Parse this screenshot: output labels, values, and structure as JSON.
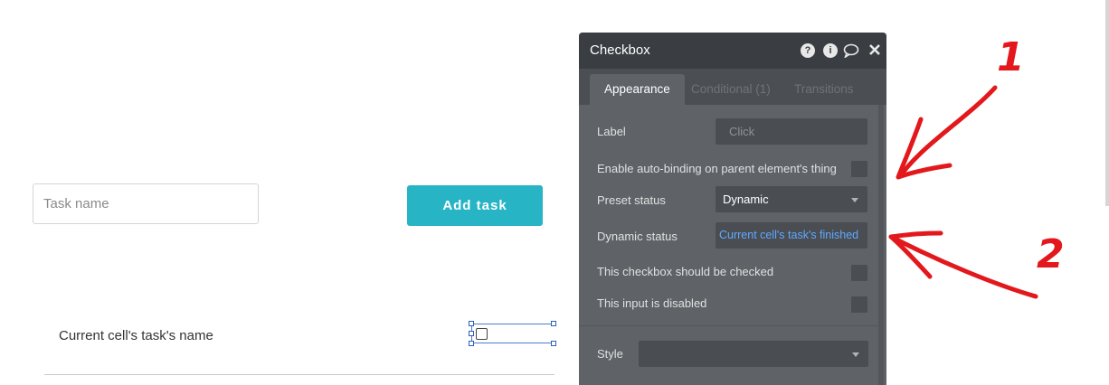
{
  "canvas": {
    "task_input_placeholder": "Task name",
    "add_button_label": "Add task",
    "cell_text": "Current cell's task's name"
  },
  "panel": {
    "title": "Checkbox",
    "header_icons": [
      "help-icon",
      "info-icon",
      "comment-icon",
      "close-icon"
    ],
    "tabs": [
      {
        "label": "Appearance",
        "active": true
      },
      {
        "label": "Conditional (1)",
        "active": false
      },
      {
        "label": "Transitions",
        "active": false
      }
    ],
    "label_field": {
      "label": "Label",
      "placeholder": "Click"
    },
    "auto_binding": {
      "label": "Enable auto-binding on parent element's thing",
      "checked": false
    },
    "preset_status": {
      "label": "Preset status",
      "value": "Dynamic"
    },
    "dynamic_status": {
      "label": "Dynamic status",
      "value": "Current cell's task's finished"
    },
    "should_be_checked": {
      "label": "This checkbox should be checked",
      "checked": false
    },
    "input_disabled": {
      "label": "This input is disabled",
      "checked": false
    },
    "style": {
      "label": "Style",
      "value": ""
    }
  },
  "annotations": {
    "one": "1",
    "two": "2",
    "color": "#e3181c"
  },
  "colors": {
    "accent_button": "#27b4c5",
    "panel_bg": "#5f6368",
    "panel_header": "#3a3e43",
    "dynamic_link": "#5fa8ff"
  }
}
